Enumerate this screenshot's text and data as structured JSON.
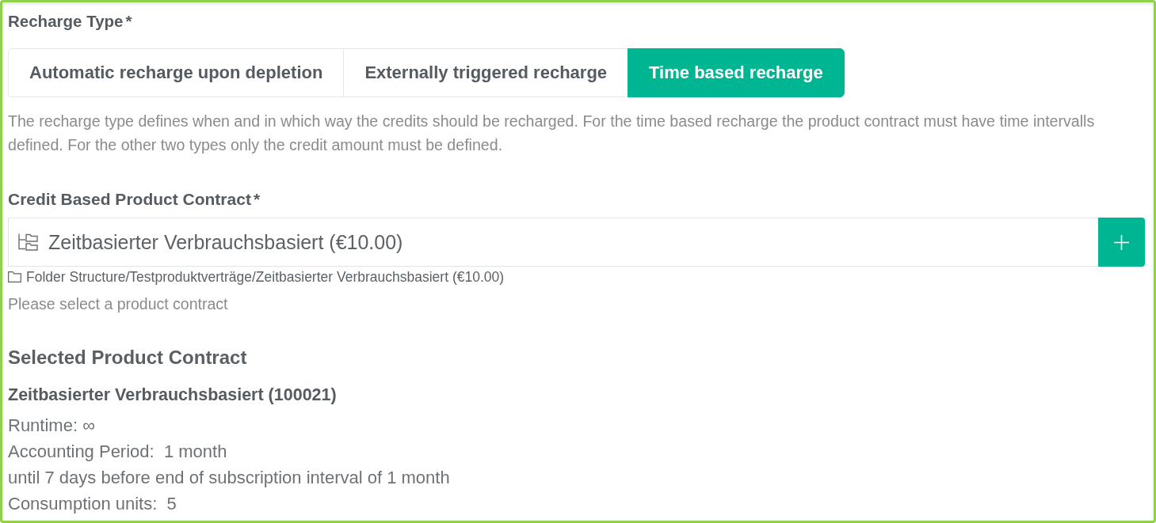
{
  "recharge_type": {
    "label": "Recharge Type",
    "required_mark": "*",
    "options": [
      {
        "label": "Automatic recharge upon depletion",
        "selected": false
      },
      {
        "label": "Externally triggered recharge",
        "selected": false
      },
      {
        "label": "Time based recharge",
        "selected": true
      }
    ],
    "help": "The recharge type defines when and in which way the credits should be recharged. For the time based recharge the product contract must have time intervalls defined. For the other two types only the credit amount must be defined."
  },
  "product_contract": {
    "label": "Credit Based Product Contract",
    "required_mark": "*",
    "value": "Zeitbasierter Verbrauchsbasiert (€10.00)",
    "path": "Folder Structure/Testproduktverträge/Zeitbasierter Verbrauchsbasiert (€10.00)",
    "hint": "Please select a product contract"
  },
  "selected_contract": {
    "heading": "Selected Product Contract",
    "name": "Zeitbasierter Verbrauchsbasiert (100021)",
    "details": [
      "Runtime: ∞",
      "Accounting Period:  1 month",
      "until 7 days before end of subscription interval of 1 month",
      "Consumption units:  5"
    ]
  }
}
